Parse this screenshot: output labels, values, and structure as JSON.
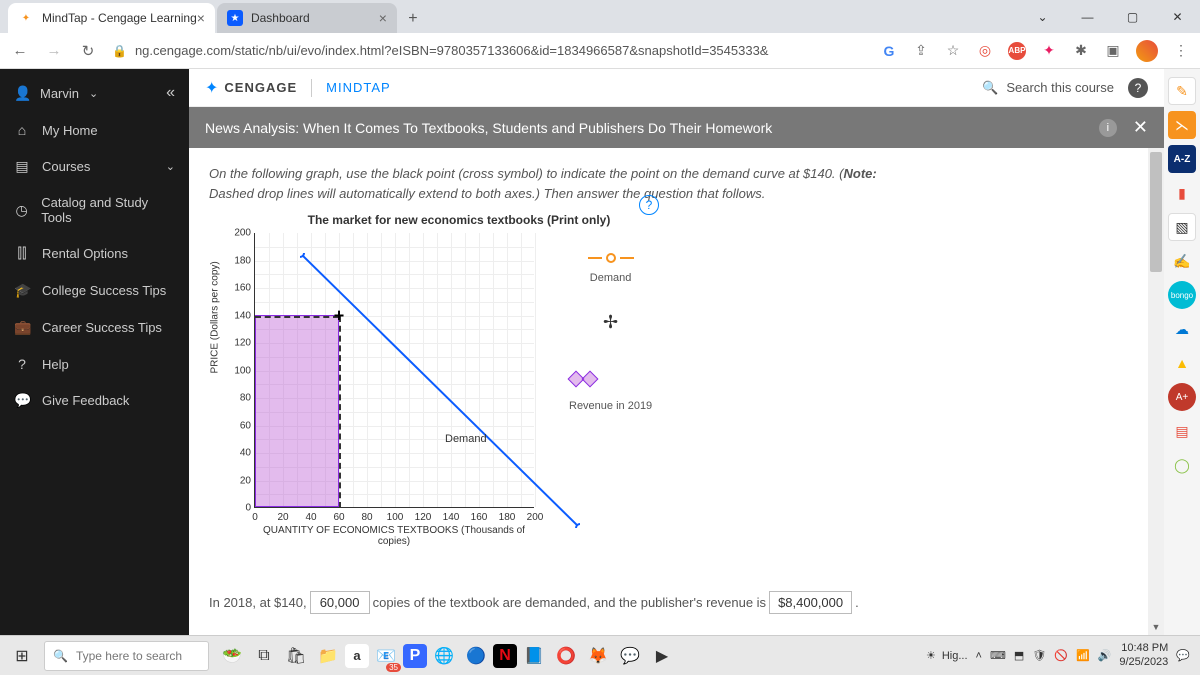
{
  "tabs": {
    "t1": "MindTap - Cengage Learning",
    "t2": "Dashboard"
  },
  "url": "ng.cengage.com/static/nb/ui/evo/index.html?eISBN=9780357133606&id=1834966587&snapshotId=3545333&",
  "user": "Marvin",
  "sidebar": {
    "home": "My Home",
    "courses": "Courses",
    "catalog": "Catalog and Study Tools",
    "rental": "Rental Options",
    "college": "College Success Tips",
    "career": "Career Success Tips",
    "help": "Help",
    "feedback": "Give Feedback"
  },
  "brand": {
    "cengage": "CENGAGE",
    "mindtap": "MINDTAP"
  },
  "search": "Search this course",
  "page_title": "News Analysis: When It Comes To Textbooks, Students and Publishers Do Their Homework",
  "instruction_pre": "On the following graph, use the black point (cross symbol) to indicate the point on the demand curve at $140. (",
  "instruction_note": "Note:",
  "instruction_post": " Dashed drop lines will automatically extend to both axes.) Then answer the question that follows.",
  "legend": {
    "demand": "Demand",
    "revenue": "Revenue in 2019"
  },
  "answer": {
    "pre": "In 2018, at $140,",
    "qty": "60,000",
    "mid": "copies of the textbook are demanded, and the publisher's revenue is",
    "rev": "$8,400,000",
    "end": "."
  },
  "searchbox": "Type here to search",
  "tray": {
    "weather": "Hig...",
    "time": "10:48 PM",
    "date": "9/25/2023",
    "mail": "35"
  },
  "chart_data": {
    "type": "line",
    "title": "The market for new economics textbooks (Print only)",
    "xlabel": "QUANTITY OF ECONOMICS TEXTBOOKS (Thousands of copies)",
    "ylabel": "PRICE (Dollars per copy)",
    "xlim": [
      0,
      200
    ],
    "ylim": [
      0,
      200
    ],
    "xticks": [
      0,
      20,
      40,
      60,
      80,
      100,
      120,
      140,
      160,
      180,
      200
    ],
    "yticks": [
      0,
      20,
      40,
      60,
      80,
      100,
      120,
      140,
      160,
      180,
      200
    ],
    "series": [
      {
        "name": "Demand",
        "x": [
          0,
          200
        ],
        "y": [
          200,
          0
        ]
      }
    ],
    "point": {
      "x": 60,
      "y": 140
    },
    "shaded_rect": {
      "x0": 0,
      "y0": 0,
      "x1": 60,
      "y1": 140
    },
    "demand_label": "Demand"
  }
}
